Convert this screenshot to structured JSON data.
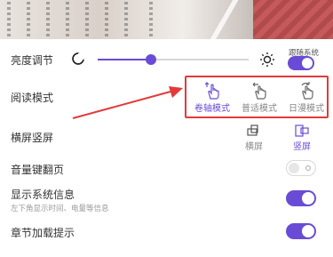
{
  "brightness": {
    "label": "亮度调节",
    "level_percent": 35,
    "follow_system_label": "跟随系统",
    "follow_system_on": true
  },
  "reading_mode": {
    "label": "阅读模式",
    "options": [
      {
        "label": "卷轴模式",
        "icon": "scroll-hand-icon",
        "active": true
      },
      {
        "label": "普适模式",
        "icon": "swipe-hand-icon",
        "active": false
      },
      {
        "label": "日漫模式",
        "icon": "page-turn-hand-icon",
        "active": false
      }
    ]
  },
  "orientation": {
    "label": "横屏竖屏",
    "options": [
      {
        "label": "横屏",
        "active": false
      },
      {
        "label": "竖屏",
        "active": true
      }
    ]
  },
  "volume_page": {
    "label": "音量键翻页",
    "on": false
  },
  "system_info": {
    "label": "显示系统信息",
    "sublabel": "左下角显示时间、电量等信息",
    "on": true
  },
  "chapter_tip": {
    "label": "章节加载提示",
    "on": true
  },
  "colors": {
    "accent": "#6a4bd6",
    "highlight": "#e23a3a"
  }
}
